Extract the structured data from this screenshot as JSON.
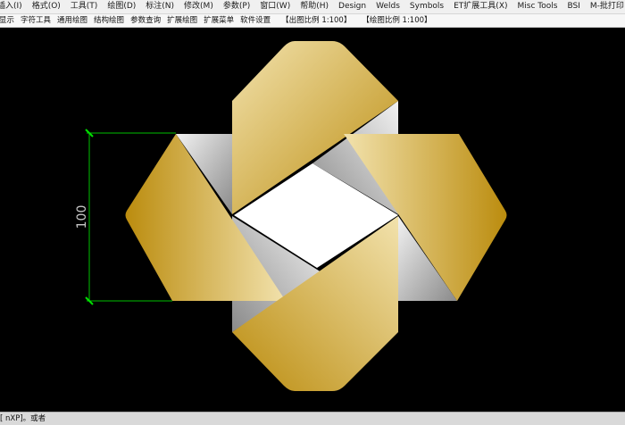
{
  "menu": [
    "插入(I)",
    "格式(O)",
    "工具(T)",
    "绘图(D)",
    "标注(N)",
    "修改(M)",
    "参数(P)",
    "窗口(W)",
    "帮助(H)",
    "Design",
    "Welds",
    "Symbols",
    "ET扩展工具(X)",
    "Misc Tools",
    "BSI",
    "M-批打印"
  ],
  "toolbar": [
    "显示",
    "字符工具",
    "通用绘图",
    "结构绘图",
    "参数查询",
    "扩展绘图",
    "扩展菜单",
    "软件设置"
  ],
  "scales": {
    "output": "【出图比例 1:100】",
    "drawing": "【绘图比例 1:100】"
  },
  "dimension": {
    "value": "100"
  },
  "command_line": "[ nXP]。或者",
  "colors": {
    "gold_dark": "#bb8c0e",
    "gold_light": "#f2e2ad",
    "silver_dark": "#8a8a8a",
    "silver_light": "#f2f2f2",
    "dimension_green": "#00c000",
    "background": "#000000"
  }
}
